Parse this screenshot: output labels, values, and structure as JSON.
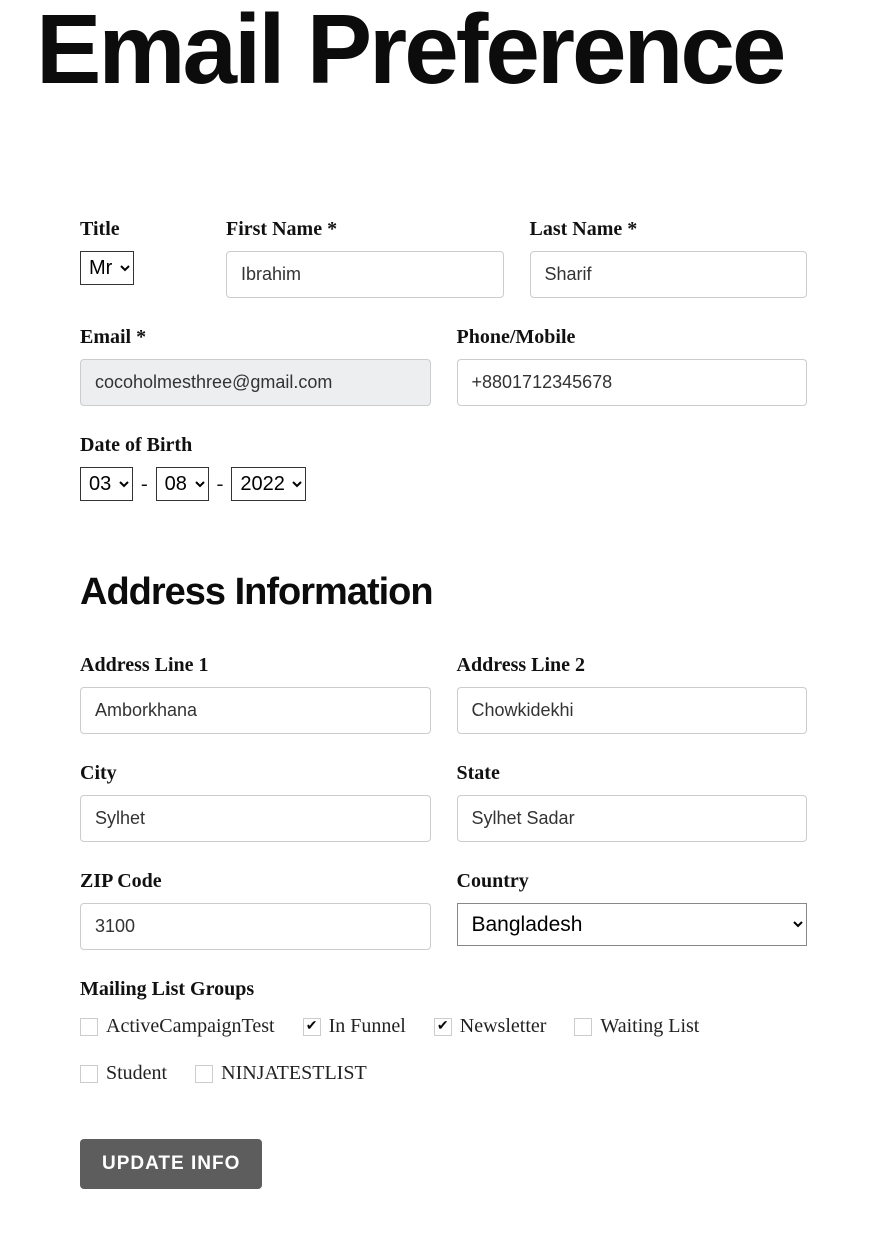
{
  "page": {
    "title": "Email Preference"
  },
  "labels": {
    "title": "Title",
    "first_name": "First Name *",
    "last_name": "Last Name *",
    "email": "Email *",
    "phone": "Phone/Mobile",
    "dob": "Date of Birth",
    "address1": "Address Line 1",
    "address2": "Address Line 2",
    "city": "City",
    "state": "State",
    "zip": "ZIP Code",
    "country": "Country",
    "mailing": "Mailing List Groups"
  },
  "values": {
    "title": "Mr",
    "first_name": "Ibrahim",
    "last_name": "Sharif",
    "email": "cocoholmesthree@gmail.com",
    "phone": "+8801712345678",
    "dob_day": "03",
    "dob_month": "08",
    "dob_year": "2022",
    "address1": "Amborkhana",
    "address2": "Chowkidekhi",
    "city": "Sylhet",
    "state": "Sylhet Sadar",
    "zip": "3100",
    "country": "Bangladesh"
  },
  "sections": {
    "address": "Address Information"
  },
  "mailing_lists": [
    {
      "label": "ActiveCampaignTest",
      "checked": false
    },
    {
      "label": "In Funnel",
      "checked": true
    },
    {
      "label": "Newsletter",
      "checked": true
    },
    {
      "label": "Waiting List",
      "checked": false
    },
    {
      "label": "Student",
      "checked": false
    },
    {
      "label": "NINJATESTLIST",
      "checked": false
    }
  ],
  "buttons": {
    "submit": "UPDATE INFO"
  },
  "separators": {
    "dob": "-"
  }
}
